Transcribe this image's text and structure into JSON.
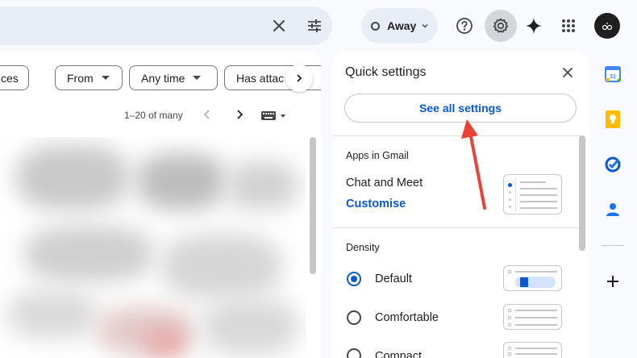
{
  "topbar": {
    "status_label": "Away",
    "icons": [
      "close-icon",
      "search-options-icon",
      "help-icon",
      "settings-icon",
      "gemini-icon",
      "apps-grid-icon",
      "account-avatar"
    ]
  },
  "filters": {
    "chips": [
      {
        "label": "ces",
        "has_caret": false
      },
      {
        "label": "From",
        "has_caret": true
      },
      {
        "label": "Any time",
        "has_caret": true
      },
      {
        "label": "Has attac",
        "has_caret": false
      }
    ]
  },
  "pager": {
    "range_label": "1–20 of many"
  },
  "quick_settings": {
    "title": "Quick settings",
    "see_all_label": "See all settings",
    "apps_section": {
      "heading": "Apps in Gmail",
      "chat_meet_label": "Chat and Meet",
      "customise_label": "Customise"
    },
    "density_section": {
      "heading": "Density",
      "options": [
        {
          "label": "Default",
          "selected": true
        },
        {
          "label": "Comfortable",
          "selected": false
        },
        {
          "label": "Compact",
          "selected": false
        }
      ]
    }
  },
  "side_panel": {
    "apps": [
      "calendar-icon",
      "keep-icon",
      "tasks-icon",
      "contacts-icon",
      "add-icon"
    ]
  },
  "colors": {
    "accent": "#0b57d0",
    "annotation": "#ea4335",
    "background": "#f8fafd"
  }
}
